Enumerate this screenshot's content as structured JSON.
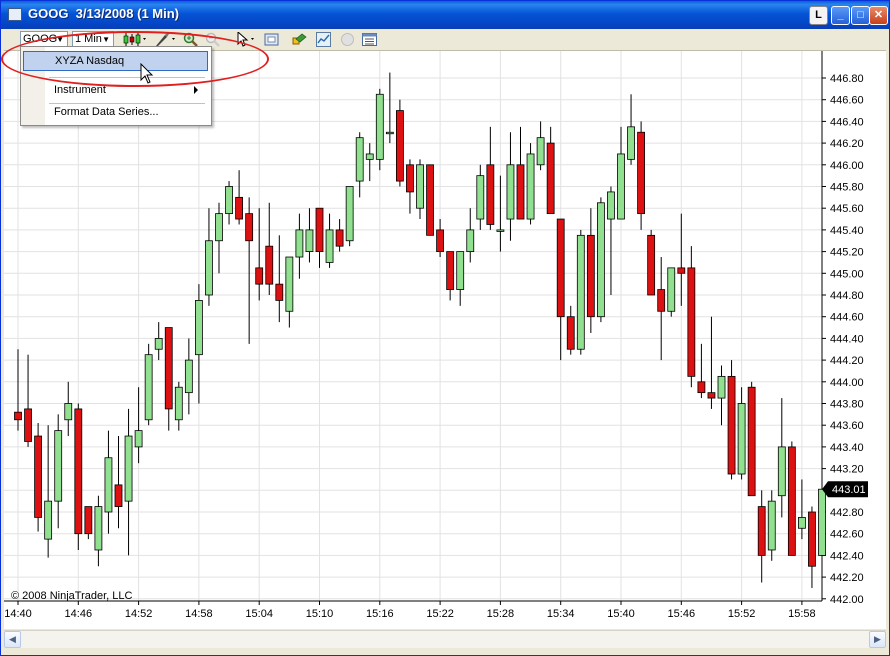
{
  "window": {
    "title": "GOOG  3/13/2008 (1 Min)",
    "buttons": {
      "l": "L",
      "minimize": "_",
      "maximize": "□",
      "close": "✕"
    }
  },
  "toolbar": {
    "instrument": "GOOG",
    "interval": "1 Min",
    "icons": [
      "candlestick-style-icon",
      "drawing-tool-icon",
      "zoom-in-icon",
      "zoom-out-icon",
      "pointer-icon",
      "properties-icon",
      "indicators-icon",
      "strategies-icon",
      "disabled-circle-icon",
      "data-box-icon"
    ]
  },
  "context_menu": {
    "items": [
      "XYZA Nasdaq",
      "Instrument",
      "Format Data Series..."
    ],
    "highlighted": 0
  },
  "copyright": "© 2008 NinjaTrader, LLC",
  "last_price": "443.01",
  "colors": {
    "up": "#90e090",
    "down": "#dd1111",
    "grid": "#e2e2e2",
    "annotation": "#e02020"
  },
  "chart_data": {
    "type": "candlestick",
    "y_ticks": [
      "446.80",
      "446.60",
      "446.40",
      "446.20",
      "446.00",
      "445.80",
      "445.60",
      "445.40",
      "445.20",
      "445.00",
      "444.80",
      "444.60",
      "444.40",
      "444.20",
      "444.00",
      "443.80",
      "443.60",
      "443.40",
      "443.20",
      "443.00",
      "442.80",
      "442.60",
      "442.40",
      "442.20",
      "442.00"
    ],
    "x_ticks": [
      "14:40",
      "14:46",
      "14:52",
      "14:58",
      "15:04",
      "15:10",
      "15:16",
      "15:22",
      "15:28",
      "15:34",
      "15:40",
      "15:46",
      "15:52",
      "15:58"
    ],
    "ylim": [
      441.95,
      447.0
    ],
    "candles": [
      {
        "o": 443.72,
        "h": 444.3,
        "l": 443.55,
        "c": 443.65
      },
      {
        "o": 443.75,
        "h": 444.25,
        "l": 443.4,
        "c": 443.45
      },
      {
        "o": 443.5,
        "h": 443.62,
        "l": 442.62,
        "c": 442.75
      },
      {
        "o": 442.55,
        "h": 443.6,
        "l": 442.38,
        "c": 442.9
      },
      {
        "o": 442.9,
        "h": 443.7,
        "l": 442.65,
        "c": 443.55
      },
      {
        "o": 443.65,
        "h": 444.0,
        "l": 443.5,
        "c": 443.8
      },
      {
        "o": 443.75,
        "h": 443.8,
        "l": 442.45,
        "c": 442.6
      },
      {
        "o": 442.85,
        "h": 442.85,
        "l": 442.55,
        "c": 442.6
      },
      {
        "o": 442.45,
        "h": 442.95,
        "l": 442.3,
        "c": 442.85
      },
      {
        "o": 442.8,
        "h": 443.55,
        "l": 442.6,
        "c": 443.3
      },
      {
        "o": 443.05,
        "h": 443.5,
        "l": 442.65,
        "c": 442.85
      },
      {
        "o": 442.9,
        "h": 443.75,
        "l": 442.4,
        "c": 443.5
      },
      {
        "o": 443.4,
        "h": 443.95,
        "l": 443.25,
        "c": 443.55
      },
      {
        "o": 443.65,
        "h": 444.35,
        "l": 443.6,
        "c": 444.25
      },
      {
        "o": 444.3,
        "h": 444.55,
        "l": 444.2,
        "c": 444.4
      },
      {
        "o": 444.5,
        "h": 444.5,
        "l": 443.55,
        "c": 443.75
      },
      {
        "o": 443.65,
        "h": 444.0,
        "l": 443.55,
        "c": 443.95
      },
      {
        "o": 443.9,
        "h": 444.4,
        "l": 443.7,
        "c": 444.2
      },
      {
        "o": 444.25,
        "h": 444.9,
        "l": 443.8,
        "c": 444.75
      },
      {
        "o": 444.8,
        "h": 445.6,
        "l": 444.7,
        "c": 445.3
      },
      {
        "o": 445.3,
        "h": 445.65,
        "l": 445.0,
        "c": 445.55
      },
      {
        "o": 445.55,
        "h": 445.85,
        "l": 445.45,
        "c": 445.8
      },
      {
        "o": 445.7,
        "h": 445.95,
        "l": 445.45,
        "c": 445.5
      },
      {
        "o": 445.55,
        "h": 445.7,
        "l": 444.35,
        "c": 445.3
      },
      {
        "o": 445.05,
        "h": 445.6,
        "l": 444.75,
        "c": 444.9
      },
      {
        "o": 445.25,
        "h": 445.65,
        "l": 444.8,
        "c": 444.9
      },
      {
        "o": 444.9,
        "h": 445.35,
        "l": 444.55,
        "c": 444.75
      },
      {
        "o": 444.65,
        "h": 445.15,
        "l": 444.5,
        "c": 445.15
      },
      {
        "o": 445.15,
        "h": 445.55,
        "l": 444.95,
        "c": 445.4
      },
      {
        "o": 445.2,
        "h": 445.6,
        "l": 445.1,
        "c": 445.4
      },
      {
        "o": 445.6,
        "h": 445.6,
        "l": 445.05,
        "c": 445.2
      },
      {
        "o": 445.1,
        "h": 445.55,
        "l": 445.05,
        "c": 445.4
      },
      {
        "o": 445.4,
        "h": 445.5,
        "l": 445.2,
        "c": 445.25
      },
      {
        "o": 445.3,
        "h": 445.8,
        "l": 445.25,
        "c": 445.8
      },
      {
        "o": 445.85,
        "h": 446.3,
        "l": 445.7,
        "c": 446.25
      },
      {
        "o": 446.05,
        "h": 446.2,
        "l": 445.85,
        "c": 446.1
      },
      {
        "o": 446.05,
        "h": 446.7,
        "l": 445.95,
        "c": 446.65
      },
      {
        "o": 446.3,
        "h": 446.85,
        "l": 446.2,
        "c": 446.3
      },
      {
        "o": 446.5,
        "h": 446.6,
        "l": 445.8,
        "c": 445.85
      },
      {
        "o": 446.0,
        "h": 446.05,
        "l": 445.55,
        "c": 445.75
      },
      {
        "o": 445.6,
        "h": 446.05,
        "l": 445.5,
        "c": 446.0
      },
      {
        "o": 446.0,
        "h": 446.0,
        "l": 445.35,
        "c": 445.35
      },
      {
        "o": 445.4,
        "h": 445.5,
        "l": 445.15,
        "c": 445.2
      },
      {
        "o": 445.2,
        "h": 445.2,
        "l": 444.75,
        "c": 444.85
      },
      {
        "o": 444.85,
        "h": 445.2,
        "l": 444.7,
        "c": 445.2
      },
      {
        "o": 445.2,
        "h": 445.6,
        "l": 445.1,
        "c": 445.4
      },
      {
        "o": 445.5,
        "h": 446.0,
        "l": 445.4,
        "c": 445.9
      },
      {
        "o": 446.0,
        "h": 446.35,
        "l": 445.4,
        "c": 445.45
      },
      {
        "o": 445.4,
        "h": 445.9,
        "l": 445.2,
        "c": 445.4
      },
      {
        "o": 445.5,
        "h": 446.3,
        "l": 445.3,
        "c": 446.0
      },
      {
        "o": 446.0,
        "h": 446.35,
        "l": 445.5,
        "c": 445.5
      },
      {
        "o": 445.5,
        "h": 446.2,
        "l": 445.45,
        "c": 446.1
      },
      {
        "o": 446.0,
        "h": 446.4,
        "l": 445.95,
        "c": 446.25
      },
      {
        "o": 446.2,
        "h": 446.35,
        "l": 445.55,
        "c": 445.55
      },
      {
        "o": 445.5,
        "h": 445.5,
        "l": 444.2,
        "c": 444.6
      },
      {
        "o": 444.6,
        "h": 444.7,
        "l": 444.25,
        "c": 444.3
      },
      {
        "o": 444.3,
        "h": 445.4,
        "l": 444.25,
        "c": 445.35
      },
      {
        "o": 445.35,
        "h": 445.6,
        "l": 444.45,
        "c": 444.6
      },
      {
        "o": 444.6,
        "h": 445.7,
        "l": 444.55,
        "c": 445.65
      },
      {
        "o": 445.5,
        "h": 445.8,
        "l": 444.8,
        "c": 445.75
      },
      {
        "o": 445.5,
        "h": 446.35,
        "l": 445.5,
        "c": 446.1
      },
      {
        "o": 446.05,
        "h": 446.65,
        "l": 446.0,
        "c": 446.35
      },
      {
        "o": 446.3,
        "h": 446.4,
        "l": 445.4,
        "c": 445.55
      },
      {
        "o": 445.35,
        "h": 445.4,
        "l": 444.8,
        "c": 444.8
      },
      {
        "o": 444.85,
        "h": 445.15,
        "l": 444.2,
        "c": 444.65
      },
      {
        "o": 444.65,
        "h": 445.05,
        "l": 444.6,
        "c": 445.05
      },
      {
        "o": 445.05,
        "h": 445.55,
        "l": 444.7,
        "c": 445.0
      },
      {
        "o": 445.05,
        "h": 445.25,
        "l": 443.95,
        "c": 444.05
      },
      {
        "o": 444.0,
        "h": 444.35,
        "l": 443.85,
        "c": 443.9
      },
      {
        "o": 443.9,
        "h": 444.6,
        "l": 443.75,
        "c": 443.85
      },
      {
        "o": 443.85,
        "h": 444.15,
        "l": 443.6,
        "c": 444.05
      },
      {
        "o": 444.05,
        "h": 444.2,
        "l": 443.1,
        "c": 443.15
      },
      {
        "o": 443.15,
        "h": 443.95,
        "l": 443.1,
        "c": 443.8
      },
      {
        "o": 443.95,
        "h": 444.0,
        "l": 442.95,
        "c": 442.95
      },
      {
        "o": 442.85,
        "h": 443.0,
        "l": 442.15,
        "c": 442.4
      },
      {
        "o": 442.45,
        "h": 443.0,
        "l": 442.35,
        "c": 442.9
      },
      {
        "o": 442.95,
        "h": 443.85,
        "l": 442.75,
        "c": 443.4
      },
      {
        "o": 443.4,
        "h": 443.45,
        "l": 442.4,
        "c": 442.4
      },
      {
        "o": 442.65,
        "h": 443.1,
        "l": 442.55,
        "c": 442.75
      },
      {
        "o": 442.8,
        "h": 442.85,
        "l": 442.1,
        "c": 442.3
      },
      {
        "o": 442.4,
        "h": 443.55,
        "l": 442.4,
        "c": 443.01
      }
    ]
  }
}
